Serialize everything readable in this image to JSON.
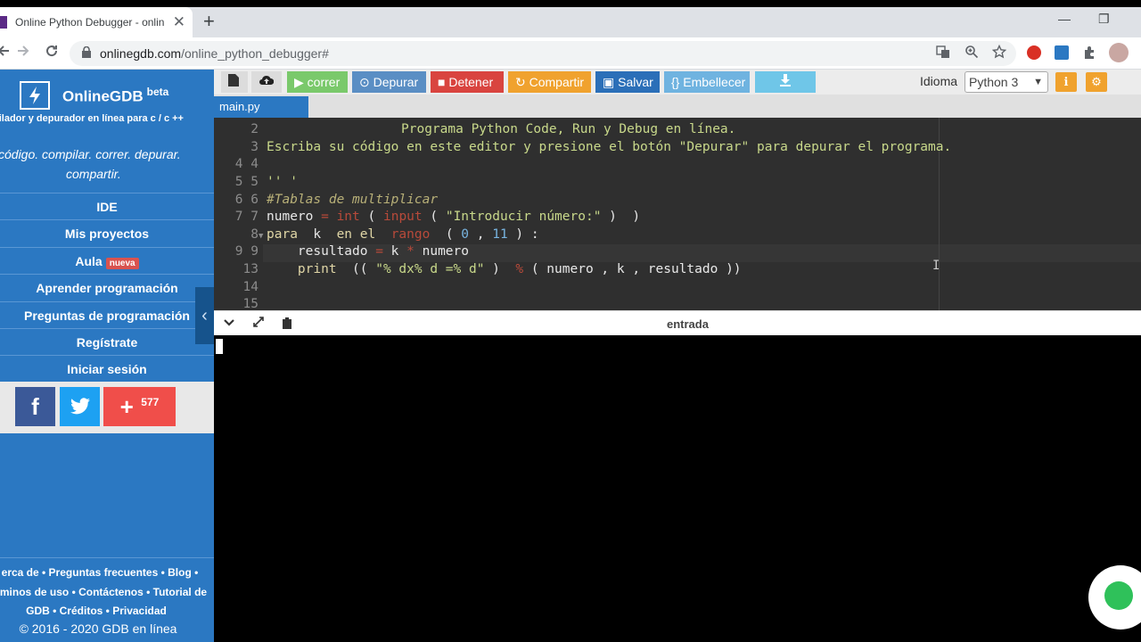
{
  "browser": {
    "tab_title": "Online Python Debugger - online",
    "tab_close": "✕",
    "new_tab": "+",
    "url_host": "onlinegdb.com",
    "url_path": "/online_python_debugger#",
    "win_min": "—",
    "win_restore": "❐",
    "win_close": "✕"
  },
  "sidebar": {
    "logo": "OnlineGDB",
    "beta": "beta",
    "tagline": "pilador y depurador en línea para c / c ++",
    "slogan_line1": "código. compilar. correr. depurar.",
    "slogan_line2": "compartir.",
    "menu": [
      {
        "label": "IDE"
      },
      {
        "label": "Mis proyectos"
      },
      {
        "label": "Aula",
        "badge": "nueva"
      },
      {
        "label": "Aprender programación"
      },
      {
        "label": "Preguntas de programación"
      },
      {
        "label": "Regístrate"
      },
      {
        "label": "Iniciar sesión"
      }
    ],
    "share_count": "577",
    "footer": [
      "erca de • Preguntas frecuentes • Blog •",
      "minos de uso • Contáctenos • Tutorial de",
      "GDB • Créditos • Privacidad"
    ],
    "copyright": "© 2016 - 2020 GDB en línea"
  },
  "toolbar": {
    "run": "correr",
    "debug": "Depurar",
    "stop": "Detener",
    "share": "Compartir",
    "save": "Salvar",
    "beautify": "{} Embellecer",
    "language_label": "Idioma",
    "language_value": "Python 3"
  },
  "file_tab": "main.py",
  "editor": {
    "gutter": [
      "",
      "2",
      "3",
      "4 4",
      "5 5",
      "6 6",
      "7 7",
      "8",
      "9 9",
      "13",
      "14",
      "15"
    ],
    "line0": "Programa Python Code, Run y Debug en línea.",
    "line1": "Escriba su código en este editor y presione el botón \"Depurar\" para depurar el programa.",
    "line3": "'' '",
    "line4": "#Tablas de multiplicar"
  },
  "io": {
    "label": "entrada"
  },
  "colors": {
    "sidebar": "#2b78c2",
    "run": "#7ac96b",
    "debug": "#5a8ec4",
    "stop": "#d9443f",
    "share": "#f0a22e",
    "save": "#2b6fb8",
    "beautify": "#6fb3e0"
  }
}
